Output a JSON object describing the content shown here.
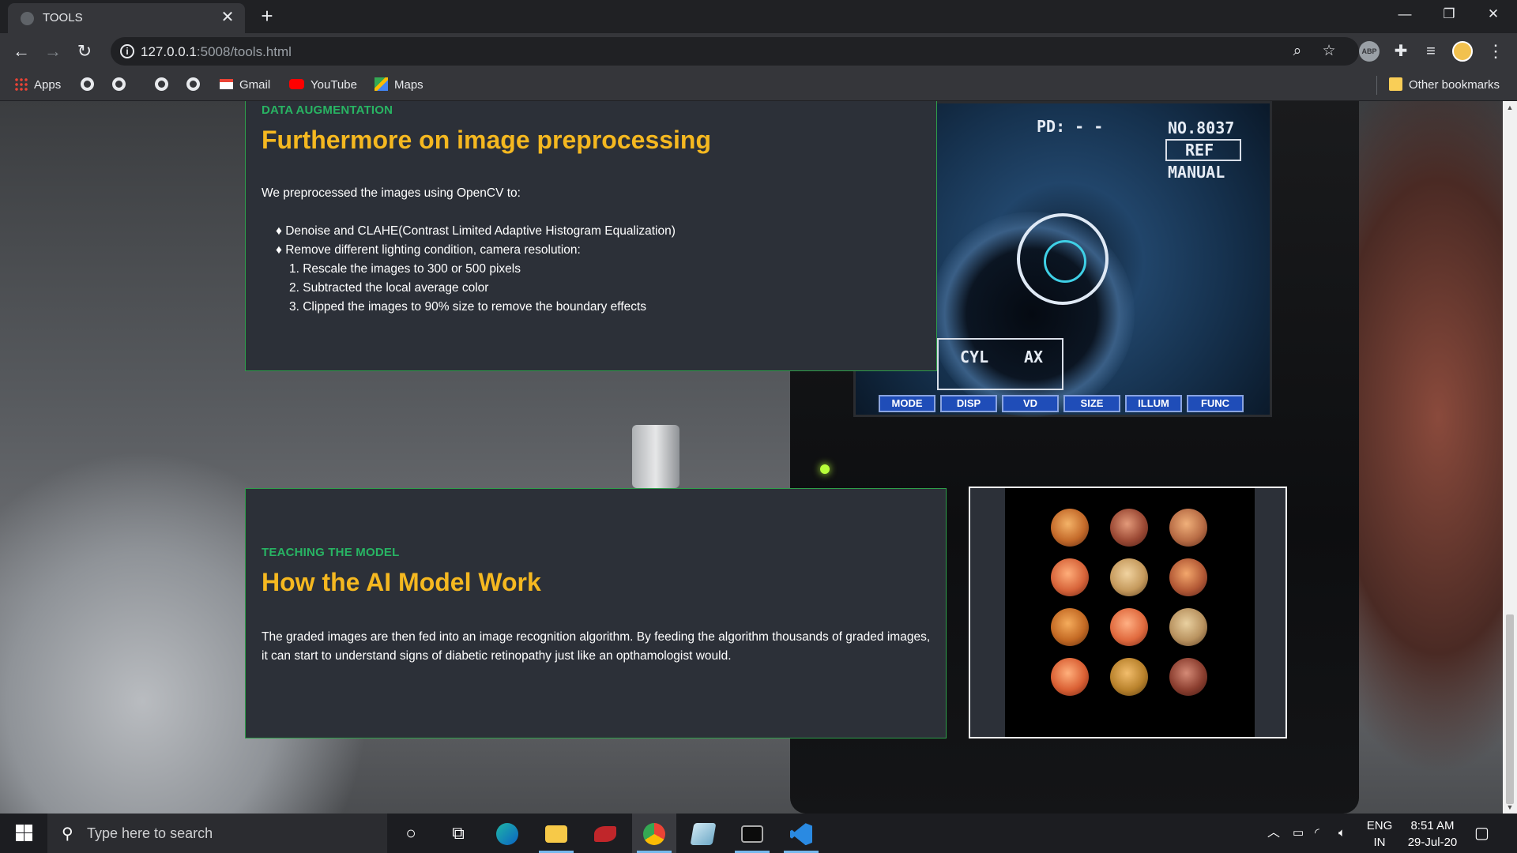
{
  "browser": {
    "tab": {
      "title": "TOOLS",
      "favicon": "globe-icon",
      "close_glyph": "✕"
    },
    "new_tab_glyph": "+",
    "window_controls": {
      "minimize": "—",
      "restore": "❐",
      "close": "✕"
    },
    "toolbar": {
      "back": "←",
      "forward": "→",
      "reload": "↻"
    },
    "address": {
      "host": "127.0.0.1",
      "path": ":5008/tools.html"
    },
    "omnibox_icons": {
      "zoom": "⌕",
      "bookmark_star": "☆"
    },
    "extensions": [
      {
        "name": "ABP"
      }
    ],
    "menu_glyph": "⋮",
    "bookmarks": {
      "apps": "Apps",
      "gmail": "Gmail",
      "youtube": "YouTube",
      "maps": "Maps",
      "other": "Other bookmarks"
    }
  },
  "page": {
    "augmentation": {
      "eyebrow": "DATA AUGMENTATION",
      "title": "Furthermore on image preprocessing",
      "intro": "We preprocessed the images using OpenCV to:",
      "bullets": [
        "♦ Denoise and CLAHE(Contrast Limited Adaptive Histogram Equalization)",
        "♦ Remove different lighting condition, camera resolution:"
      ],
      "steps": [
        "1. Rescale the images to 300 or 500 pixels",
        "2. Subtracted the local average color",
        "3. Clipped the images to 90% size to remove the boundary effects"
      ]
    },
    "model": {
      "eyebrow": "TEACHING THE MODEL",
      "title": "How the AI Model Work",
      "text": "The graded images are then fed into an image recognition algorithm. By feeding the algorithm thousands of graded images, it can start to understand signs of diabetic retinopathy just like an opthamologist would."
    },
    "device_screen": {
      "pd": "PD: - -",
      "number": "NO.8037",
      "ref": "REF",
      "manual": "MANUAL",
      "cyl": "CYL",
      "ax": "AX",
      "buttons": [
        "MODE",
        "DISP",
        "VD",
        "SIZE",
        "ILLUM",
        "FUNC"
      ]
    }
  },
  "taskbar": {
    "search_placeholder": "Type here to search",
    "language": {
      "code": "ENG",
      "region": "IN"
    },
    "time": "8:51 AM",
    "date": "29-Jul-20"
  }
}
